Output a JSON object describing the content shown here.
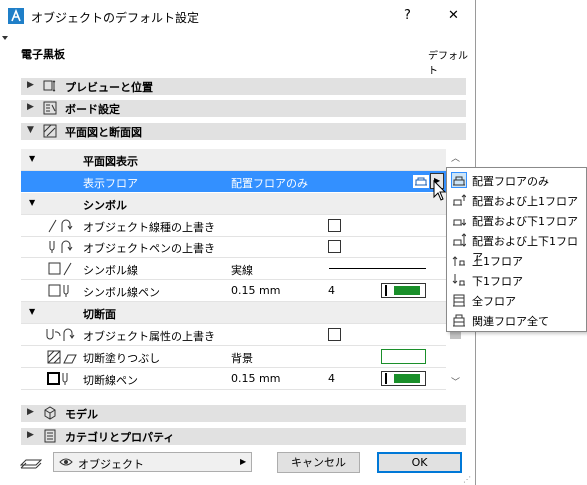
{
  "window": {
    "title": "オブジェクトのデフォルト設定",
    "help_label": "?",
    "close_label": "✕"
  },
  "header": {
    "library_name": "電子黒板",
    "right_label": "デフォルト"
  },
  "sections": {
    "preview": "プレビューと位置",
    "board": "ボード設定",
    "plan_section": "平面図と断面図",
    "model": "モデル",
    "category": "カテゴリとプロパティ"
  },
  "plan_display": {
    "header": "平面図表示",
    "show_on_stories_label": "表示フロア",
    "show_on_stories_value": "配置フロアのみ"
  },
  "symbol": {
    "header": "シンボル",
    "override_line_type": "オブジェクト線種の上書き",
    "override_pen": "オブジェクトペンの上書き",
    "symbol_line_label": "シンボル線",
    "symbol_line_value": "実線",
    "symbol_pen_label": "シンボル線ペン",
    "symbol_pen_weight": "0.15 mm",
    "symbol_pen_number": "4"
  },
  "cut": {
    "header": "切断面",
    "override_attributes": "オブジェクト属性の上書き",
    "cut_fill_label": "切断塗りつぶし",
    "cut_fill_value": "背景",
    "cut_pen_label": "切断線ペン",
    "cut_pen_weight": "0.15 mm",
    "cut_pen_number": "4"
  },
  "footer": {
    "layer_value": "オブジェクト",
    "cancel_label": "キャンセル",
    "ok_label": "OK"
  },
  "dropdown": {
    "items": [
      "配置フロアのみ",
      "配置および上1フロア",
      "配置および下1フロア",
      "配置および上下1フロア",
      "上1フロア",
      "下1フロア",
      "全フロア",
      "関連フロア全て"
    ]
  },
  "colors": {
    "selection": "#3390ff",
    "section_header": "#e1e1e1",
    "pen_green": "#1a8f2a",
    "popup_highlight": "#cce4f7"
  }
}
